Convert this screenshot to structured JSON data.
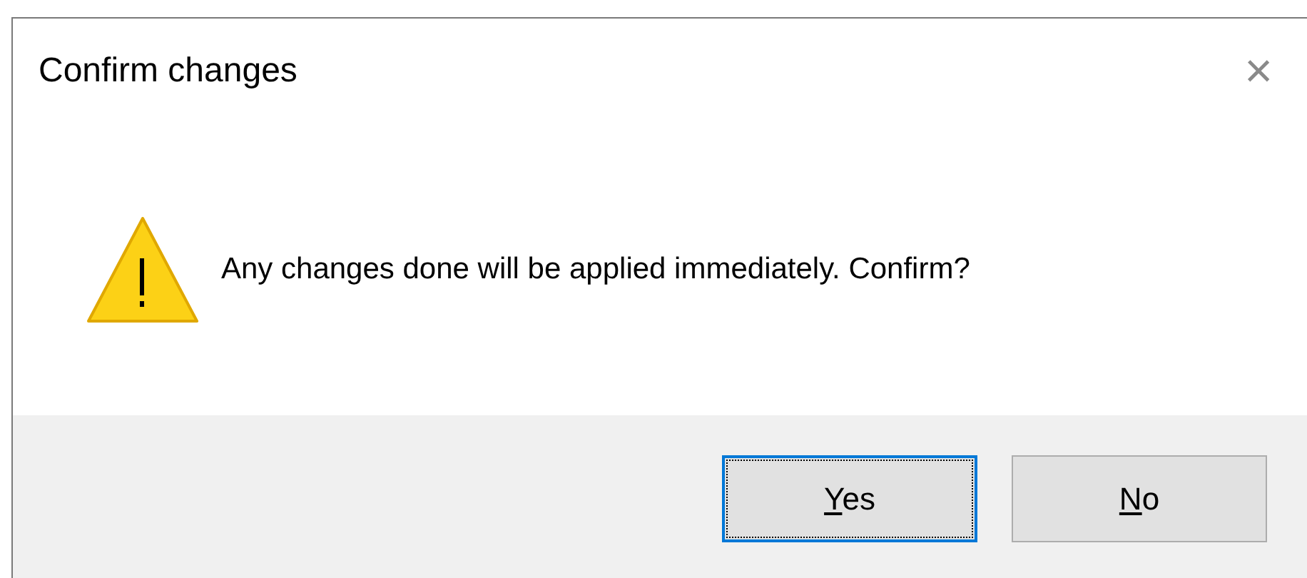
{
  "window": {
    "title": "Confirm changes",
    "close": "×"
  },
  "message": {
    "kind": "warning",
    "text": "Any changes done will be applied immediately. Confirm?"
  },
  "buttons": [
    {
      "access_key": "Y",
      "label_rest": "es",
      "default": true
    },
    {
      "access_key": "N",
      "label_rest": "o",
      "default": false
    }
  ]
}
